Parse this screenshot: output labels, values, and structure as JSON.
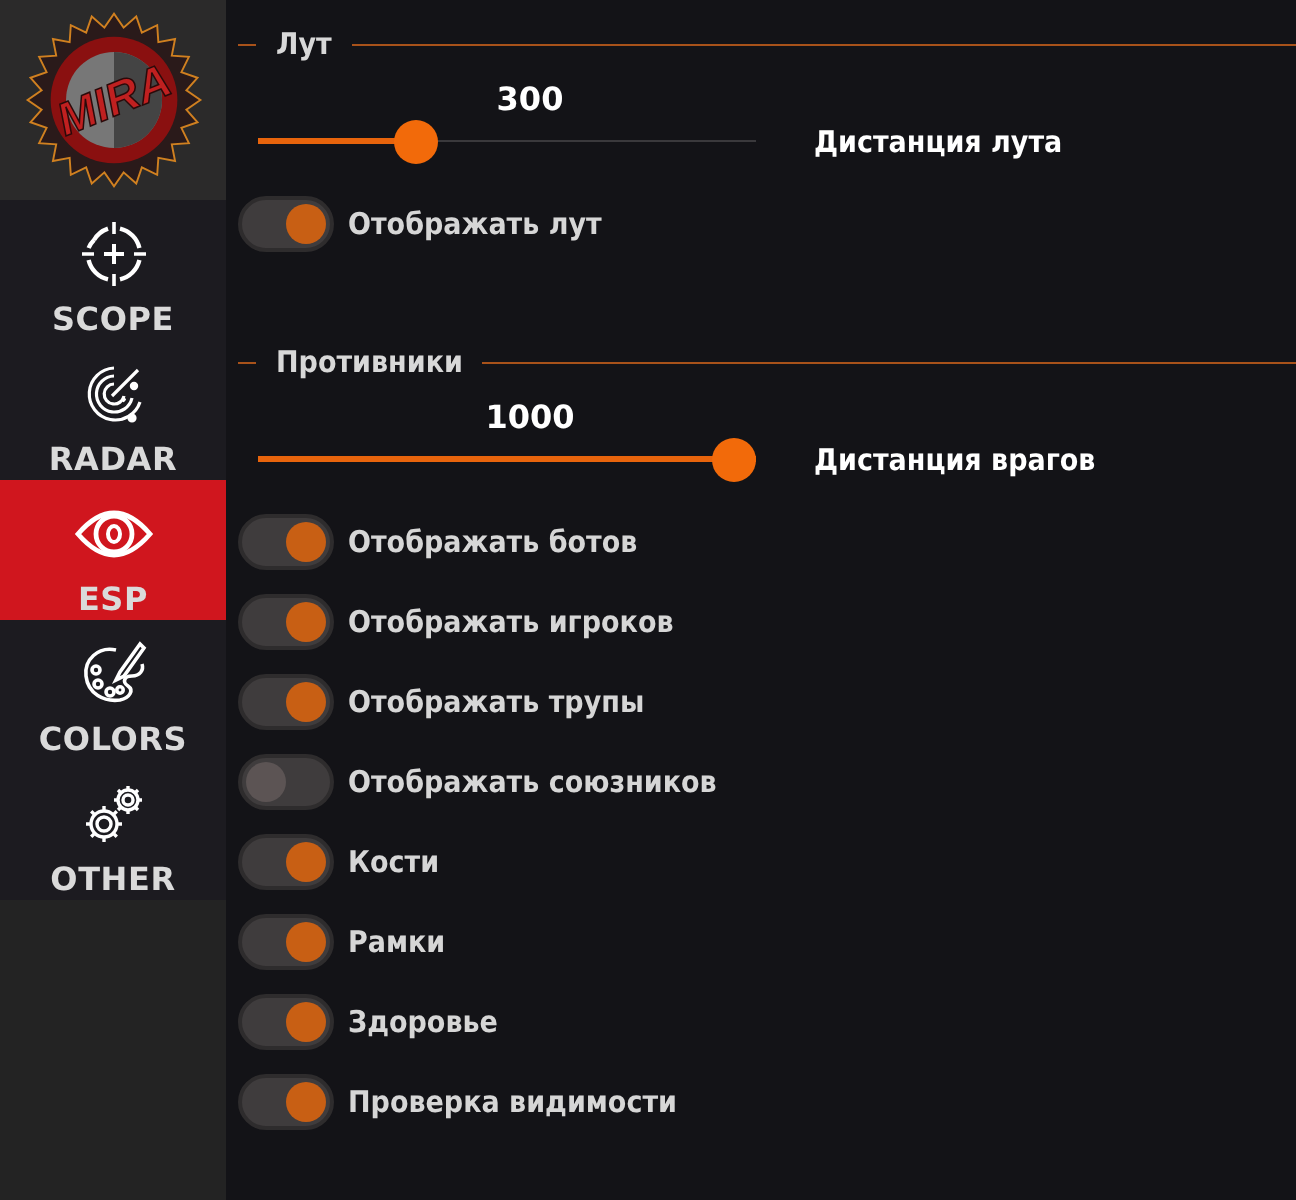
{
  "sidebar": {
    "logo": "MIRA",
    "items": [
      {
        "label": "SCOPE",
        "selected": false
      },
      {
        "label": "RADAR",
        "selected": false
      },
      {
        "label": "ESP",
        "selected": true
      },
      {
        "label": "COLORS",
        "selected": false
      },
      {
        "label": "OTHER",
        "selected": false
      }
    ]
  },
  "sections": [
    {
      "title": "Лут",
      "controls": [
        {
          "kind": "slider",
          "value": "300",
          "level": 0.3,
          "label": "Дистанция лута"
        },
        {
          "kind": "toggle",
          "label": "Отображать лут",
          "on": true
        }
      ]
    },
    {
      "title": "Противники",
      "controls": [
        {
          "kind": "slider",
          "value": "1000",
          "level": 1,
          "label": "Дистанция врагов"
        },
        {
          "kind": "toggle",
          "label": "Отображать ботов",
          "on": true
        },
        {
          "kind": "toggle",
          "label": "Отображать игроков",
          "on": true
        },
        {
          "kind": "toggle",
          "label": "Отображать трупы",
          "on": true
        },
        {
          "kind": "toggle",
          "label": "Отображать союзников",
          "on": false
        },
        {
          "kind": "toggle",
          "label": "Кости",
          "on": true
        },
        {
          "kind": "toggle",
          "label": "Рамки",
          "on": true
        },
        {
          "kind": "toggle",
          "label": "Здоровье",
          "on": true
        },
        {
          "kind": "toggle",
          "label": "Проверка видимости",
          "on": true
        }
      ]
    }
  ]
}
